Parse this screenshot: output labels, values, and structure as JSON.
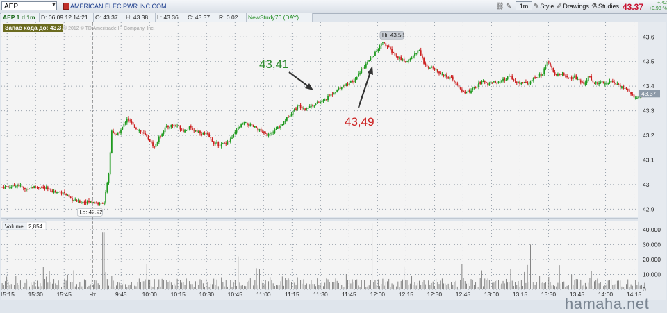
{
  "toolbar": {
    "symbol": "AEP",
    "company_name": "AMERICAN ELEC PWR INC COM",
    "timeframe_button": "1m",
    "style_label": "Style",
    "drawings_label": "Drawings",
    "studies_label": "Studies",
    "last_price": "43.37",
    "change_abs": "+.42",
    "change_pct": "+0.98 %"
  },
  "infobar": {
    "title": "AEP 1 d 1m",
    "date": "D: 06.09.12 14:21",
    "open": "O: 43.37",
    "high": "H: 43.38",
    "low": "L: 43.36",
    "close": "C: 43.37",
    "range": "R: 0.02",
    "study": "NewStudy76 (DAY)"
  },
  "chart_data": {
    "type": "candlestick",
    "title": "",
    "price_panel": {
      "ylim": [
        42.87,
        43.66
      ],
      "y_ticks": [
        "42.9",
        "43",
        "43.1",
        "43.2",
        "43.3",
        "43.4",
        "43.5",
        "43.6"
      ],
      "last_price_label": "43.37",
      "stop_label": "Запас хода до: 43.37",
      "copyright": "© 2012 © TD Ameritrade IP Company, Inc.",
      "hi_label": "Hi: 43.58",
      "lo_label": "Lo: 42.92",
      "annotations": [
        {
          "text": "43,41",
          "color": "#2e8b2e"
        },
        {
          "text": "43,49",
          "color": "#cc1f1f"
        }
      ],
      "close_path": [
        [
          0,
          42.99
        ],
        [
          5,
          42.99
        ],
        [
          10,
          43.0
        ],
        [
          15,
          42.98
        ],
        [
          20,
          42.99
        ],
        [
          25,
          42.99
        ],
        [
          30,
          42.98
        ],
        [
          35,
          42.97
        ],
        [
          40,
          42.97
        ],
        [
          45,
          42.94
        ],
        [
          50,
          42.93
        ],
        [
          55,
          42.93
        ],
        [
          60,
          42.93
        ],
        [
          64,
          42.92
        ],
        [
          67,
          42.93
        ],
        [
          70,
          43.04
        ],
        [
          72,
          43.22
        ],
        [
          75,
          43.2
        ],
        [
          78,
          43.22
        ],
        [
          82,
          43.27
        ],
        [
          86,
          43.24
        ],
        [
          90,
          43.22
        ],
        [
          94,
          43.2
        ],
        [
          98,
          43.17
        ],
        [
          100,
          43.15
        ],
        [
          103,
          43.19
        ],
        [
          107,
          43.23
        ],
        [
          111,
          43.24
        ],
        [
          115,
          43.24
        ],
        [
          119,
          43.22
        ],
        [
          123,
          43.23
        ],
        [
          127,
          43.22
        ],
        [
          131,
          43.21
        ],
        [
          135,
          43.2
        ],
        [
          139,
          43.17
        ],
        [
          143,
          43.16
        ],
        [
          147,
          43.17
        ],
        [
          151,
          43.19
        ],
        [
          155,
          43.23
        ],
        [
          159,
          43.25
        ],
        [
          163,
          43.24
        ],
        [
          167,
          43.23
        ],
        [
          171,
          43.21
        ],
        [
          175,
          43.2
        ],
        [
          179,
          43.22
        ],
        [
          183,
          43.24
        ],
        [
          187,
          43.27
        ],
        [
          191,
          43.3
        ],
        [
          195,
          43.32
        ],
        [
          199,
          43.31
        ],
        [
          203,
          43.32
        ],
        [
          207,
          43.33
        ],
        [
          211,
          43.34
        ],
        [
          215,
          43.36
        ],
        [
          219,
          43.38
        ],
        [
          223,
          43.4
        ],
        [
          227,
          43.41
        ],
        [
          231,
          43.42
        ],
        [
          235,
          43.46
        ],
        [
          239,
          43.49
        ],
        [
          243,
          43.52
        ],
        [
          247,
          43.55
        ],
        [
          250,
          43.58
        ],
        [
          253,
          43.56
        ],
        [
          256,
          43.54
        ],
        [
          259,
          43.52
        ],
        [
          262,
          43.51
        ],
        [
          265,
          43.5
        ],
        [
          268,
          43.51
        ],
        [
          271,
          43.53
        ],
        [
          274,
          43.55
        ],
        [
          277,
          43.49
        ],
        [
          280,
          43.47
        ],
        [
          283,
          43.48
        ],
        [
          286,
          43.46
        ],
        [
          289,
          43.45
        ],
        [
          292,
          43.44
        ],
        [
          295,
          43.43
        ],
        [
          298,
          43.41
        ],
        [
          301,
          43.39
        ],
        [
          304,
          43.37
        ],
        [
          307,
          43.38
        ],
        [
          310,
          43.39
        ],
        [
          313,
          43.41
        ],
        [
          316,
          43.42
        ],
        [
          319,
          43.41
        ],
        [
          322,
          43.42
        ],
        [
          325,
          43.41
        ],
        [
          328,
          43.42
        ],
        [
          331,
          43.43
        ],
        [
          334,
          43.44
        ],
        [
          337,
          43.42
        ],
        [
          340,
          43.41
        ],
        [
          343,
          43.42
        ],
        [
          346,
          43.41
        ],
        [
          349,
          43.43
        ],
        [
          352,
          43.44
        ],
        [
          355,
          43.45
        ],
        [
          358,
          43.5
        ],
        [
          361,
          43.47
        ],
        [
          364,
          43.44
        ],
        [
          367,
          43.45
        ],
        [
          370,
          43.44
        ],
        [
          373,
          43.43
        ],
        [
          376,
          43.44
        ],
        [
          379,
          43.42
        ],
        [
          382,
          43.41
        ],
        [
          385,
          43.44
        ],
        [
          388,
          43.42
        ],
        [
          391,
          43.41
        ],
        [
          394,
          43.42
        ],
        [
          397,
          43.41
        ],
        [
          400,
          43.42
        ],
        [
          403,
          43.41
        ],
        [
          406,
          43.4
        ],
        [
          409,
          43.39
        ],
        [
          412,
          43.38
        ],
        [
          415,
          43.35
        ],
        [
          418,
          43.36
        ],
        [
          420,
          43.36
        ],
        [
          422,
          43.37
        ]
      ]
    },
    "volume_panel": {
      "label": "Volume",
      "value_label": "2,854",
      "ylim": [
        0,
        46000
      ],
      "y_ticks": [
        "0",
        "10,000",
        "20,000",
        "30,000",
        "40,000"
      ]
    },
    "x_axis": {
      "tick_labels": [
        "15:15",
        "15:30",
        "15:45",
        "Чт",
        "9:45",
        "10:00",
        "10:15",
        "10:30",
        "10:45",
        "11:00",
        "11:15",
        "11:30",
        "11:45",
        "12:00",
        "12:15",
        "12:30",
        "12:45",
        "13:00",
        "13:15",
        "13:30",
        "13:45",
        "14:00",
        "14:15"
      ],
      "tick_minutes": [
        0,
        15,
        30,
        45,
        60,
        75,
        90,
        105,
        120,
        135,
        150,
        165,
        180,
        195,
        210,
        225,
        240,
        255,
        270,
        285,
        300,
        315,
        330
      ],
      "minute_range": [
        -3,
        332
      ],
      "bar_minute_range": [
        -3,
        336
      ]
    },
    "colors": {
      "up": "#1f9a1f",
      "down": "#cc1f1f",
      "background": "#f4f4f4",
      "grid": "#9aa3ad"
    },
    "grid": true
  },
  "watermark": "hamaha.net"
}
